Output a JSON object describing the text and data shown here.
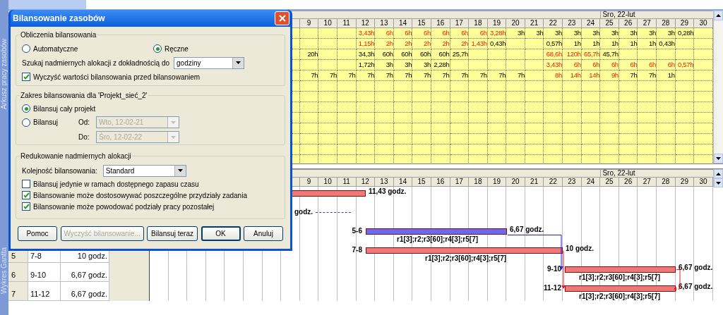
{
  "view_bar": {
    "top_label": "Arkusz pracy zasobów",
    "bottom_label": "Wykres Gantta"
  },
  "usage": {
    "date_header": "Śro, 22-lut",
    "days": [
      "9",
      "10",
      "11",
      "12",
      "13",
      "14",
      "15",
      "16",
      "17",
      "18",
      "19",
      "20",
      "21",
      "22",
      "23",
      "24",
      "25",
      "26",
      "27",
      "28",
      "29",
      "30"
    ],
    "rows": [
      {
        "cells": [
          null,
          null,
          null,
          {
            "text": "3,43h",
            "over": true
          },
          {
            "text": "6h",
            "over": true
          },
          {
            "text": "6h",
            "over": true
          },
          {
            "text": "6h",
            "over": true
          },
          {
            "text": "6h",
            "over": true
          },
          {
            "text": "6h",
            "over": true
          },
          {
            "text": "6h",
            "over": true
          },
          {
            "text": "3,28h",
            "over": true
          },
          {
            "text": "3h",
            "over": false
          },
          {
            "text": "3h",
            "over": false
          },
          {
            "text": "3h",
            "over": false
          },
          {
            "text": "3h",
            "over": false
          },
          {
            "text": "3h",
            "over": false
          },
          {
            "text": "3h",
            "over": false
          },
          {
            "text": "3h",
            "over": false
          },
          {
            "text": "3h",
            "over": false
          },
          {
            "text": "3h",
            "over": false
          },
          {
            "text": "0,28h",
            "over": false
          },
          null
        ]
      },
      {
        "cells": [
          null,
          null,
          null,
          {
            "text": "1,15h",
            "over": true
          },
          {
            "text": "2h",
            "over": true
          },
          {
            "text": "2h",
            "over": true
          },
          {
            "text": "2h",
            "over": true
          },
          {
            "text": "2h",
            "over": true
          },
          {
            "text": "2h",
            "over": true
          },
          {
            "text": "1,43h",
            "over": true
          },
          {
            "text": "0,43h",
            "over": false
          },
          null,
          null,
          {
            "text": "0,57h",
            "over": false
          },
          {
            "text": "1h",
            "over": false
          },
          {
            "text": "1h",
            "over": false
          },
          {
            "text": "1h",
            "over": false
          },
          {
            "text": "1h",
            "over": false
          },
          {
            "text": "1h",
            "over": false
          },
          {
            "text": "0,43h",
            "over": false
          },
          null,
          null
        ]
      },
      {
        "cells": [
          {
            "text": "20h",
            "over": false
          },
          null,
          null,
          {
            "text": "34,3h",
            "over": false
          },
          {
            "text": "60h",
            "over": false
          },
          {
            "text": "60h",
            "over": false
          },
          {
            "text": "60h",
            "over": false
          },
          {
            "text": "60h",
            "over": false
          },
          {
            "text": "25,7h",
            "over": false
          },
          null,
          null,
          null,
          null,
          {
            "text": "68,6h",
            "over": true
          },
          {
            "text": "120h",
            "over": true
          },
          {
            "text": "65,7h",
            "over": true
          },
          {
            "text": "45,7h",
            "over": false
          },
          null,
          null,
          null,
          null,
          null
        ]
      },
      {
        "cells": [
          null,
          null,
          null,
          {
            "text": "1,72h",
            "over": false
          },
          {
            "text": "3h",
            "over": false
          },
          {
            "text": "3h",
            "over": false
          },
          {
            "text": "3h",
            "over": false
          },
          {
            "text": "2,28h",
            "over": false
          },
          null,
          null,
          null,
          null,
          null,
          {
            "text": "3,43h",
            "over": true
          },
          {
            "text": "6h",
            "over": true
          },
          {
            "text": "6h",
            "over": true
          },
          {
            "text": "6h",
            "over": true
          },
          {
            "text": "6h",
            "over": true
          },
          {
            "text": "6h",
            "over": true
          },
          {
            "text": "6h",
            "over": true
          },
          {
            "text": "0,57h",
            "over": true
          },
          null
        ]
      },
      {
        "cells": [
          {
            "text": "7h",
            "over": false
          },
          {
            "text": "7h",
            "over": false
          },
          {
            "text": "7h",
            "over": false
          },
          {
            "text": "7h",
            "over": false
          },
          {
            "text": "7h",
            "over": false
          },
          {
            "text": "7h",
            "over": false
          },
          {
            "text": "7h",
            "over": false
          },
          {
            "text": "7h",
            "over": false
          },
          {
            "text": "7h",
            "over": false
          },
          {
            "text": "7h",
            "over": false
          },
          {
            "text": "7h",
            "over": false
          },
          {
            "text": "7h",
            "over": false
          },
          null,
          {
            "text": "8h",
            "over": true
          },
          {
            "text": "14h",
            "over": true
          },
          {
            "text": "14h",
            "over": true
          },
          {
            "text": "9h",
            "over": true
          },
          {
            "text": "7h",
            "over": false
          },
          {
            "text": "7h",
            "over": false
          },
          {
            "text": "1h",
            "over": false
          },
          null,
          null
        ]
      }
    ]
  },
  "gantt": {
    "date_header": "Śro, 22-lut",
    "days": [
      "9",
      "10",
      "11",
      "12",
      "13",
      "14",
      "15",
      "16",
      "17",
      "18",
      "19",
      "20",
      "21",
      "22",
      "23",
      "24",
      "25",
      "26",
      "27",
      "28",
      "29",
      "30"
    ],
    "table_rows": [
      {
        "id": "5",
        "name": "7-8",
        "work": "10 godz."
      },
      {
        "id": "6",
        "name": "9-10",
        "work": "6,67 godz."
      },
      {
        "id": "7",
        "name": "11-12",
        "work": "6,67 godz."
      }
    ],
    "tasks": [
      {
        "kind": "bar",
        "color": "#f07878",
        "duration": "11,43 godz."
      },
      {
        "kind": "line",
        "color": "#3a3af0",
        "duration": "godz."
      },
      {
        "kind": "bar",
        "color": "#6a6af0",
        "name": "5-6",
        "duration": "6,67 godz.",
        "resources": "r1[3];r2;r3[60];r4[3];r5[7]"
      },
      {
        "kind": "bar",
        "color": "#f07878",
        "name": "7-8",
        "duration": "10 godz.",
        "resources": "r1[3];r2;r3[60];r4[3];r5[7]"
      },
      {
        "kind": "bar",
        "color": "#f07878",
        "name": "9-10",
        "duration": "6,67 godz.",
        "resources": "r1[3];r2;r3[60];r4[3];r5[7]"
      },
      {
        "kind": "bar",
        "color": "#f07878",
        "name": "11-12",
        "duration": "6,67 godz.",
        "resources": "r1[3];r2;r3[60];r4[3];r5[7]"
      }
    ]
  },
  "dialog": {
    "title": "Bilansowanie zasobów",
    "calc_group": {
      "title": "Obliczenia bilansowania",
      "modes": [
        {
          "label": "Automatyczne",
          "selected": false
        },
        {
          "label": "Ręczne",
          "selected": true
        }
      ],
      "granularity_label": "Szukaj nadmiernych alokacji z dokładnością do",
      "granularity": "godziny",
      "clear_values": {
        "label": "Wyczyść wartości bilansowania przed bilansowaniem",
        "checked": true
      }
    },
    "range_group": {
      "title": "Zakres bilansowania dla 'Projekt_sieć_2'",
      "options": [
        {
          "label": "Bilansuj cały projekt",
          "selected": true
        },
        {
          "label": "Bilansuj",
          "selected": false
        }
      ],
      "from_label": "Od:",
      "from": "Wto, 12-02-21",
      "to_label": "Do:",
      "to": "Śro, 12-02-22",
      "dates_disabled": true
    },
    "reduce_group": {
      "title": "Redukowanie nadmiernych alokacji",
      "order_label": "Kolejność bilansowania:",
      "order": "Standard",
      "options": [
        {
          "label": "Bilansuj jedynie w ramach dostępnego zapasu czasu",
          "checked": false
        },
        {
          "label": "Bilansowanie może dostosowywać poszczególne przydziały zadania",
          "checked": true
        },
        {
          "label": "Bilansowanie może powodować podziały pracy pozostałej",
          "checked": true
        }
      ]
    },
    "buttons": [
      {
        "label": "Pomoc",
        "disabled": false,
        "default": false
      },
      {
        "label": "Wyczyść bilansowanie...",
        "disabled": true,
        "default": false
      },
      {
        "label": "Bilansuj teraz",
        "disabled": false,
        "default": false
      },
      {
        "label": "OK",
        "disabled": false,
        "default": true
      },
      {
        "label": "Anuluj",
        "disabled": false,
        "default": false
      }
    ]
  }
}
